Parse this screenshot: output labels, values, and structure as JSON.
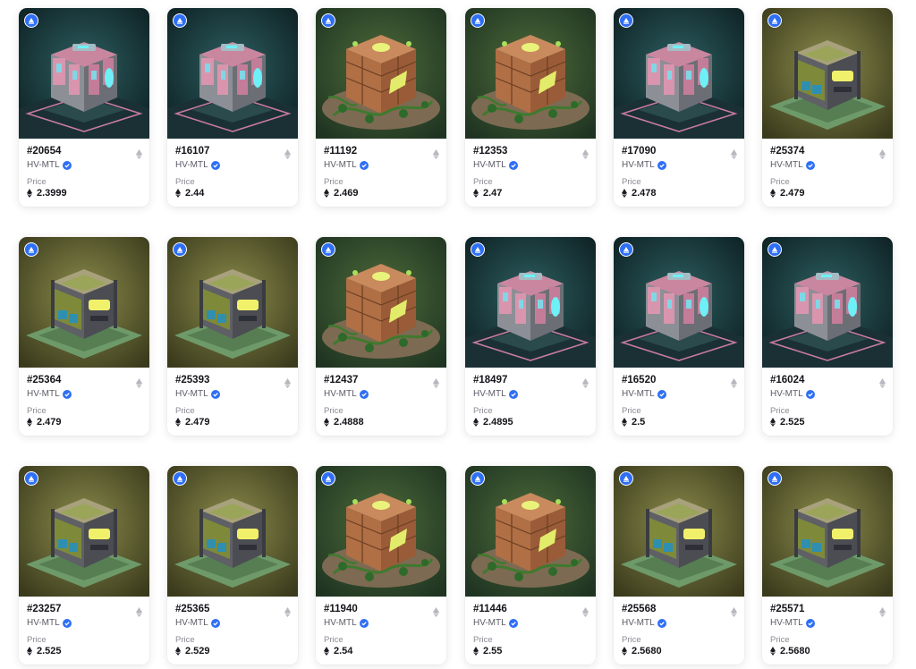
{
  "cards": [
    {
      "id": "#20654",
      "collection": "HV-MTL",
      "price_label": "Price",
      "price": "2.3999",
      "art": "pink-cube-icon"
    },
    {
      "id": "#16107",
      "collection": "HV-MTL",
      "price_label": "Price",
      "price": "2.44",
      "art": "pink-cube-icon"
    },
    {
      "id": "#11192",
      "collection": "HV-MTL",
      "price_label": "Price",
      "price": "2.469",
      "art": "vine-cube-icon"
    },
    {
      "id": "#12353",
      "collection": "HV-MTL",
      "price_label": "Price",
      "price": "2.47",
      "art": "vine-cube-icon"
    },
    {
      "id": "#17090",
      "collection": "HV-MTL",
      "price_label": "Price",
      "price": "2.478",
      "art": "pink-cube-icon"
    },
    {
      "id": "#25374",
      "collection": "HV-MTL",
      "price_label": "Price",
      "price": "2.479",
      "art": "metal-cube-icon"
    },
    {
      "id": "#25364",
      "collection": "HV-MTL",
      "price_label": "Price",
      "price": "2.479",
      "art": "metal-cube-icon"
    },
    {
      "id": "#25393",
      "collection": "HV-MTL",
      "price_label": "Price",
      "price": "2.479",
      "art": "metal-cube-icon"
    },
    {
      "id": "#12437",
      "collection": "HV-MTL",
      "price_label": "Price",
      "price": "2.4888",
      "art": "vine-cube-icon"
    },
    {
      "id": "#18497",
      "collection": "HV-MTL",
      "price_label": "Price",
      "price": "2.4895",
      "art": "pink-cube-icon"
    },
    {
      "id": "#16520",
      "collection": "HV-MTL",
      "price_label": "Price",
      "price": "2.5",
      "art": "pink-cube-icon"
    },
    {
      "id": "#16024",
      "collection": "HV-MTL",
      "price_label": "Price",
      "price": "2.525",
      "art": "pink-cube-icon"
    },
    {
      "id": "#23257",
      "collection": "HV-MTL",
      "price_label": "Price",
      "price": "2.525",
      "art": "metal-cube-icon"
    },
    {
      "id": "#25365",
      "collection": "HV-MTL",
      "price_label": "Price",
      "price": "2.529",
      "art": "metal-cube-icon"
    },
    {
      "id": "#11940",
      "collection": "HV-MTL",
      "price_label": "Price",
      "price": "2.54",
      "art": "vine-cube-icon"
    },
    {
      "id": "#11446",
      "collection": "HV-MTL",
      "price_label": "Price",
      "price": "2.55",
      "art": "vine-cube-icon"
    },
    {
      "id": "#25568",
      "collection": "HV-MTL",
      "price_label": "Price",
      "price": "2.5680",
      "art": "metal-cube-icon"
    },
    {
      "id": "#25571",
      "collection": "HV-MTL",
      "price_label": "Price",
      "price": "2.5680",
      "art": "metal-cube-icon"
    }
  ],
  "icons": {
    "chain_badge": "ethereum-chain-badge-icon",
    "verified": "verified-check-icon",
    "currency": "eth-icon"
  },
  "colors": {
    "chain_badge": "#2f6ff6",
    "verified": "#2f6ff6",
    "pink_bg": "#1f4245",
    "vine_bg": "#2f4a2c",
    "metal_bg": "#5b5a2a"
  }
}
